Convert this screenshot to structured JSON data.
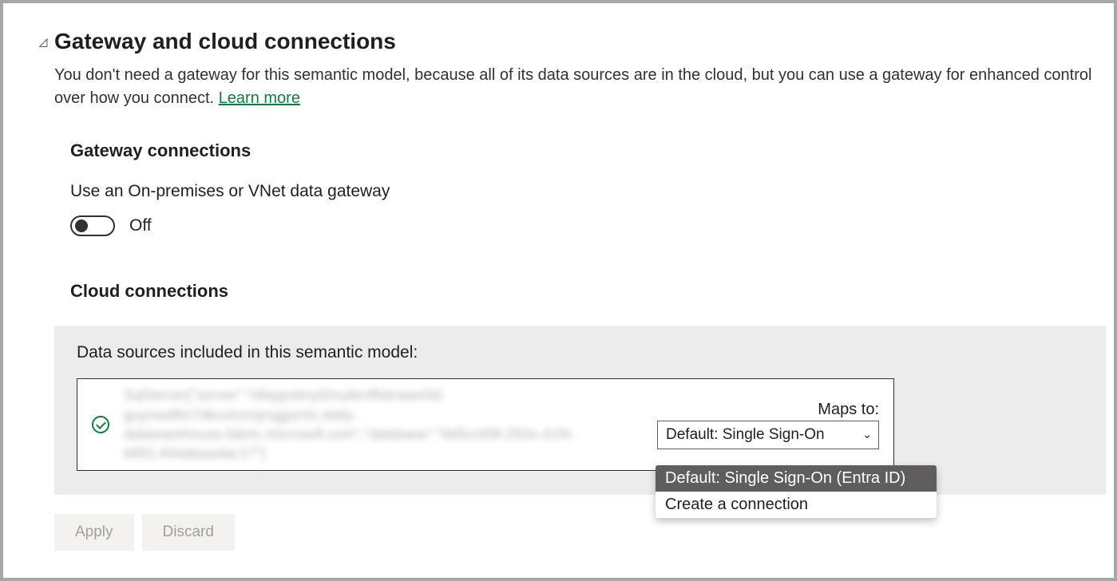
{
  "header": {
    "title": "Gateway and cloud connections",
    "description_prefix": "You don't need a gateway for this semantic model, because all of its data sources are in the cloud, but you can use a gateway for enhanced control over how you connect. ",
    "learn_more": "Learn more"
  },
  "gateway": {
    "title": "Gateway connections",
    "toggle_label": "Use an On-premises or VNet data gateway",
    "toggle_state": "Off"
  },
  "cloud": {
    "title": "Cloud connections",
    "panel_heading": "Data sources included in this semantic model:",
    "datasource_blur": "SqlServer{\"server\":\"nllaypxbnyl2nudenffxbraaxt3d-guyxwalfm7dkuvtomqrsgjpzvtz.daily-datawarehouse.fabric.microsoft.com\",\"database\":\"8d5cc69f-292e-41f4-b691-84dabaa4ac17\"}",
    "maps_label": "Maps to:",
    "select_value": "Default: Single Sign-On",
    "dropdown": {
      "opt1": "Default: Single Sign-On (Entra ID)",
      "opt2": "Create a connection"
    }
  },
  "buttons": {
    "apply": "Apply",
    "discard": "Discard"
  }
}
